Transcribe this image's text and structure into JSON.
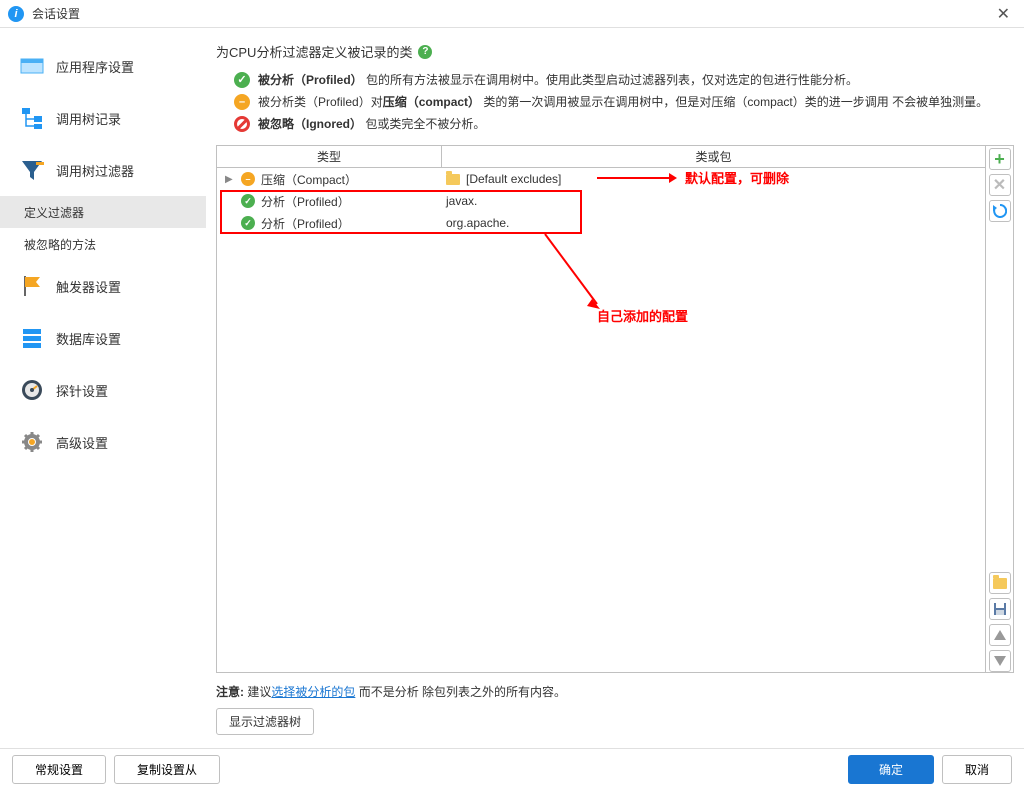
{
  "window": {
    "title": "会话设置"
  },
  "sidebar": {
    "items": [
      {
        "label": "应用程序设置"
      },
      {
        "label": "调用树记录"
      },
      {
        "label": "调用树过滤器"
      },
      {
        "label": "定义过滤器"
      },
      {
        "label": "被忽略的方法"
      },
      {
        "label": "触发器设置"
      },
      {
        "label": "数据库设置"
      },
      {
        "label": "探针设置"
      },
      {
        "label": "高级设置"
      }
    ]
  },
  "main": {
    "heading": "为CPU分析过滤器定义被记录的类",
    "desc1_prefix": "被分析（Profiled）",
    "desc1_rest": "包的所有方法被显示在调用树中。使用此类型启动过滤器列表，仅对选定的包进行性能分析。",
    "desc2_a": "被分析类（Profiled）对",
    "desc2_b": "压缩（compact）",
    "desc2_c": "类的第一次调用被显示在调用树中，但是对压缩（compact）类的进一步调用 不会被单独测量。",
    "desc3_prefix": "被忽略（Ignored）",
    "desc3_rest": "包或类完全不被分析。",
    "table": {
      "col1": "类型",
      "col2": "类或包",
      "rows": [
        {
          "type": "压缩（Compact）",
          "pkg": "[Default excludes]",
          "status": "orange",
          "hasArrow": true,
          "hasFolder": true
        },
        {
          "type": "分析（Profiled）",
          "pkg": "javax.",
          "status": "green",
          "hasArrow": false,
          "hasFolder": false
        },
        {
          "type": "分析（Profiled）",
          "pkg": "org.apache.",
          "status": "green",
          "hasArrow": false,
          "hasFolder": false
        }
      ]
    },
    "annot1": "默认配置，可删除",
    "annot2": "自己添加的配置",
    "note_label": "注意:",
    "note_a": "建议",
    "note_link": "选择被分析的包",
    "note_b": "而不是分析 除包列表之外的所有内容。",
    "show_tree": "显示过滤器树"
  },
  "footer": {
    "general": "常规设置",
    "copy": "复制设置从",
    "ok": "确定",
    "cancel": "取消"
  }
}
